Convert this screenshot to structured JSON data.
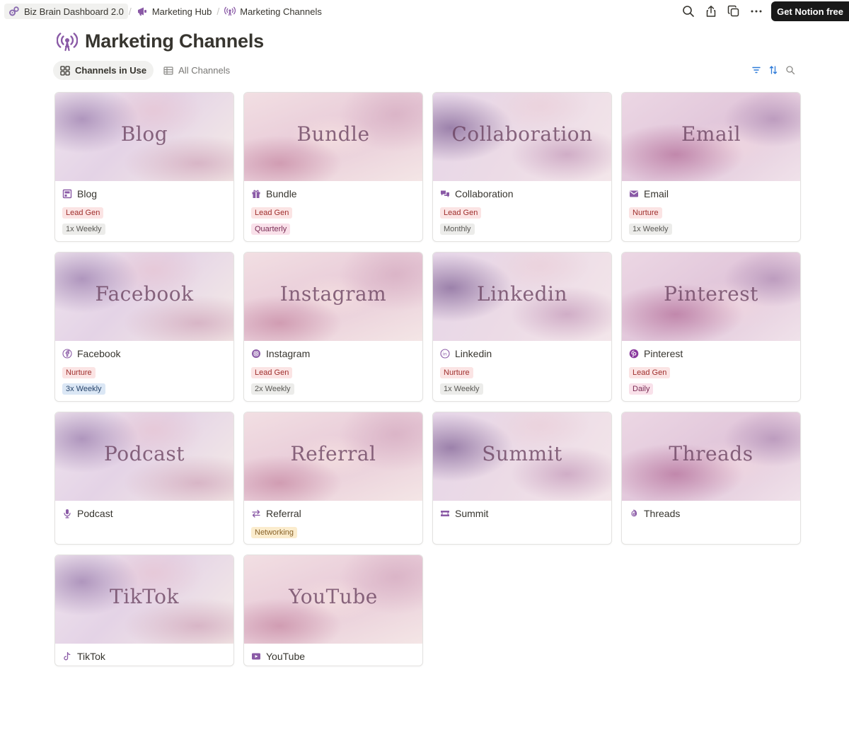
{
  "breadcrumb": [
    {
      "label": "Biz Brain Dashboard 2.0",
      "icon": "gears-icon"
    },
    {
      "label": "Marketing Hub",
      "icon": "megaphone-icon"
    },
    {
      "label": "Marketing Channels",
      "icon": "broadcast-icon"
    }
  ],
  "topbar": {
    "cta_label": "Get Notion free",
    "icons": [
      "search-icon",
      "share-icon",
      "duplicate-icon",
      "more-icon"
    ]
  },
  "page": {
    "title": "Marketing Channels",
    "icon": "broadcast-icon",
    "accent": "#8a5aa6"
  },
  "views": [
    {
      "label": "Channels in Use",
      "icon": "gallery-icon",
      "active": true
    },
    {
      "label": "All Channels",
      "icon": "table-icon",
      "active": false
    }
  ],
  "view_tools": [
    "filter-icon",
    "sort-icon",
    "search-icon"
  ],
  "cards": [
    {
      "cover_text": "Blog",
      "name": "Blog",
      "icon": "blog-icon",
      "tags": [
        {
          "label": "Lead Gen",
          "color": "red"
        },
        {
          "label": "1x Weekly",
          "color": "grey"
        }
      ]
    },
    {
      "cover_text": "Bundle",
      "name": "Bundle",
      "icon": "gift-icon",
      "tags": [
        {
          "label": "Lead Gen",
          "color": "red"
        },
        {
          "label": "Quarterly",
          "color": "pink"
        }
      ]
    },
    {
      "cover_text": "Collaboration",
      "name": "Collaboration",
      "icon": "chat-icon",
      "tags": [
        {
          "label": "Lead Gen",
          "color": "red"
        },
        {
          "label": "Monthly",
          "color": "grey"
        }
      ]
    },
    {
      "cover_text": "Email",
      "name": "Email",
      "icon": "mail-icon",
      "tags": [
        {
          "label": "Nurture",
          "color": "red"
        },
        {
          "label": "1x Weekly",
          "color": "grey"
        }
      ]
    },
    {
      "cover_text": "Facebook",
      "name": "Facebook",
      "icon": "facebook-icon",
      "tags": [
        {
          "label": "Nurture",
          "color": "red"
        },
        {
          "label": "3x Weekly",
          "color": "blue"
        }
      ]
    },
    {
      "cover_text": "Instagram",
      "name": "Instagram",
      "icon": "instagram-icon",
      "tags": [
        {
          "label": "Lead Gen",
          "color": "red"
        },
        {
          "label": "2x Weekly",
          "color": "grey"
        }
      ]
    },
    {
      "cover_text": "Linkedin",
      "name": "Linkedin",
      "icon": "linkedin-icon",
      "tags": [
        {
          "label": "Nurture",
          "color": "red"
        },
        {
          "label": "1x Weekly",
          "color": "grey"
        }
      ]
    },
    {
      "cover_text": "Pinterest",
      "name": "Pinterest",
      "icon": "pinterest-icon",
      "tags": [
        {
          "label": "Lead Gen",
          "color": "red"
        },
        {
          "label": "Daily",
          "color": "pink"
        }
      ]
    },
    {
      "cover_text": "Podcast",
      "name": "Podcast",
      "icon": "microphone-icon",
      "tags": []
    },
    {
      "cover_text": "Referral",
      "name": "Referral",
      "icon": "swap-icon",
      "tags": [
        {
          "label": "Networking",
          "color": "yellow"
        }
      ]
    },
    {
      "cover_text": "Summit",
      "name": "Summit",
      "icon": "ticket-icon",
      "tags": []
    },
    {
      "cover_text": "Threads",
      "name": "Threads",
      "icon": "threads-icon",
      "tags": []
    },
    {
      "cover_text": "TikTok",
      "name": "TikTok",
      "icon": "tiktok-icon",
      "tags": []
    },
    {
      "cover_text": "YouTube",
      "name": "YouTube",
      "icon": "youtube-icon",
      "tags": []
    }
  ]
}
